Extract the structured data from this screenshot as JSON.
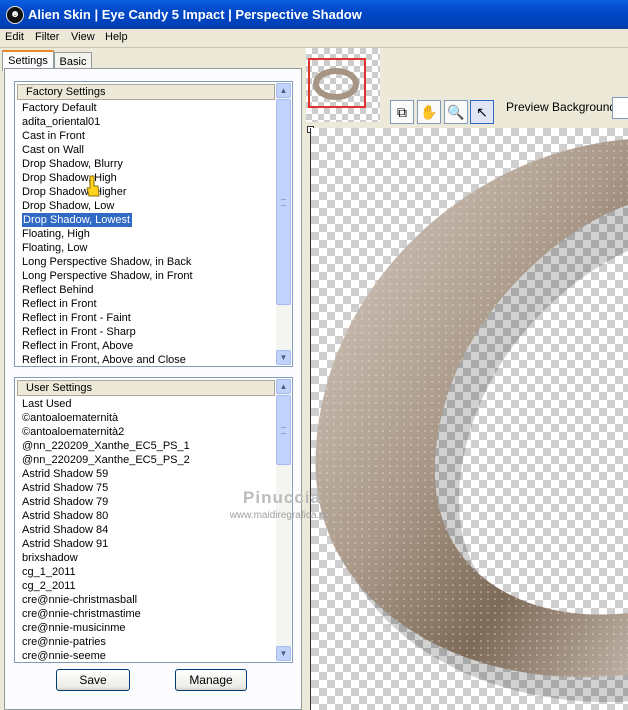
{
  "window": {
    "title": "Alien Skin  |  Eye Candy 5 Impact  |  Perspective Shadow"
  },
  "menu": {
    "items": [
      "Edit",
      "Filter",
      "View",
      "Help"
    ]
  },
  "tabs": [
    "Settings",
    "Basic"
  ],
  "factory": {
    "header": "Factory Settings",
    "items": [
      "Factory Default",
      "adita_oriental01",
      "Cast in Front",
      "Cast on Wall",
      "Drop Shadow, Blurry",
      "Drop Shadow, High",
      "Drop Shadow, Higher",
      "Drop Shadow, Low",
      "Drop Shadow, Lowest",
      "Floating, High",
      "Floating, Low",
      "Long Perspective Shadow, in Back",
      "Long Perspective Shadow, in Front",
      "Reflect Behind",
      "Reflect in Front",
      "Reflect in Front - Faint",
      "Reflect in Front - Sharp",
      "Reflect in Front, Above",
      "Reflect in Front, Above and Close"
    ],
    "selected": "Drop Shadow, Lowest"
  },
  "user": {
    "header": "User Settings",
    "items": [
      "Last Used",
      "©antoaloematernità",
      "©antoaloematernità2",
      "@nn_220209_Xanthe_EC5_PS_1",
      "@nn_220209_Xanthe_EC5_PS_2",
      "Astrid Shadow 59",
      "Astrid Shadow 75",
      "Astrid Shadow 79",
      "Astrid Shadow 80",
      "Astrid Shadow 84",
      "Astrid Shadow 91",
      "brixshadow",
      "cg_1_2011",
      "cg_2_2011",
      "cre@nnie-christmasball",
      "cre@nnie-christmastime",
      "cre@nnie-musicinme",
      "cre@nnie-patries",
      "cre@nnie-seeme"
    ]
  },
  "buttons": {
    "save": "Save",
    "manage": "Manage"
  },
  "preview": {
    "background_label": "Preview Background:"
  },
  "watermark": {
    "name": "Pinuccia",
    "site": "www.maidiregrafica.eu"
  },
  "icons": {
    "app": "alien-skin-logo-icon",
    "tools": [
      "navigate-icon",
      "hand-pan-icon",
      "zoom-icon",
      "pointer-arrow-icon"
    ]
  },
  "colors": {
    "title_bar": "#0048c8",
    "selection": "#316ac5",
    "ring": "#a69585",
    "red_frame": "#e03030"
  }
}
